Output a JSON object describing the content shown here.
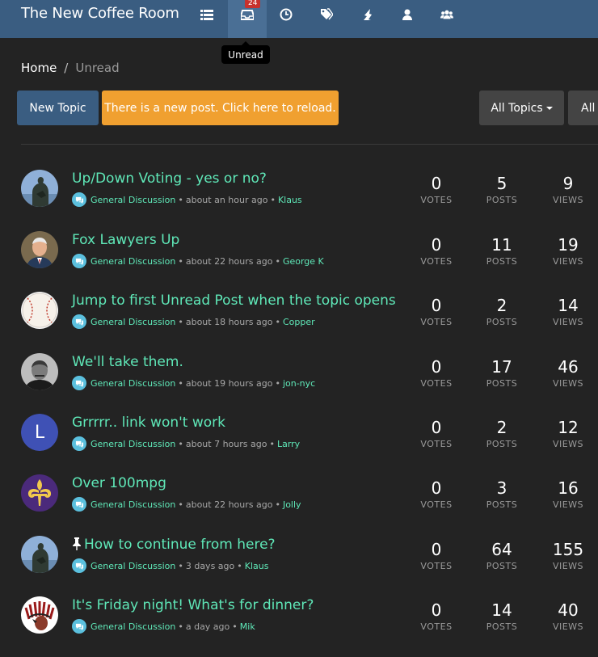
{
  "navbar": {
    "brand": "The New Coffee Room",
    "unread_badge": "24",
    "tooltip": "Unread"
  },
  "breadcrumb": {
    "home": "Home",
    "separator": "/",
    "current": "Unread"
  },
  "toolbar": {
    "new_topic": "New Topic",
    "reload_notice": "There is a new post. Click here to reload.",
    "topics_filter": "All Topics",
    "all_filter": "All"
  },
  "labels": {
    "votes": "VOTES",
    "posts": "POSTS",
    "views": "VIEWS"
  },
  "topics": [
    {
      "title": "Up/Down Voting - yes or no?",
      "category": "General Discussion",
      "time": "about an hour ago",
      "author": "Klaus",
      "votes": "0",
      "posts": "5",
      "views": "9"
    },
    {
      "title": "Fox Lawyers Up",
      "category": "General Discussion",
      "time": "about 22 hours ago",
      "author": "George K",
      "votes": "0",
      "posts": "11",
      "views": "19"
    },
    {
      "title": "Jump to first Unread Post when the topic opens",
      "category": "General Discussion",
      "time": "about 18 hours ago",
      "author": "Copper",
      "votes": "0",
      "posts": "2",
      "views": "14"
    },
    {
      "title": "We'll take them.",
      "category": "General Discussion",
      "time": "about 19 hours ago",
      "author": "jon-nyc",
      "votes": "0",
      "posts": "17",
      "views": "46"
    },
    {
      "title": "Grrrrr.. link won't work",
      "category": "General Discussion",
      "time": "about 7 hours ago",
      "author": "Larry",
      "avatar_letter": "L",
      "votes": "0",
      "posts": "2",
      "views": "12"
    },
    {
      "title": "Over 100mpg",
      "category": "General Discussion",
      "time": "about 22 hours ago",
      "author": "Jolly",
      "votes": "0",
      "posts": "3",
      "views": "16"
    },
    {
      "title": "How to continue from here?",
      "category": "General Discussion",
      "time": "3 days ago",
      "author": "Klaus",
      "pinned": true,
      "votes": "0",
      "posts": "64",
      "views": "155"
    },
    {
      "title": "It's Friday night! What's for dinner?",
      "category": "General Discussion",
      "time": "a day ago",
      "author": "Mik",
      "votes": "0",
      "posts": "14",
      "views": "40"
    }
  ]
}
